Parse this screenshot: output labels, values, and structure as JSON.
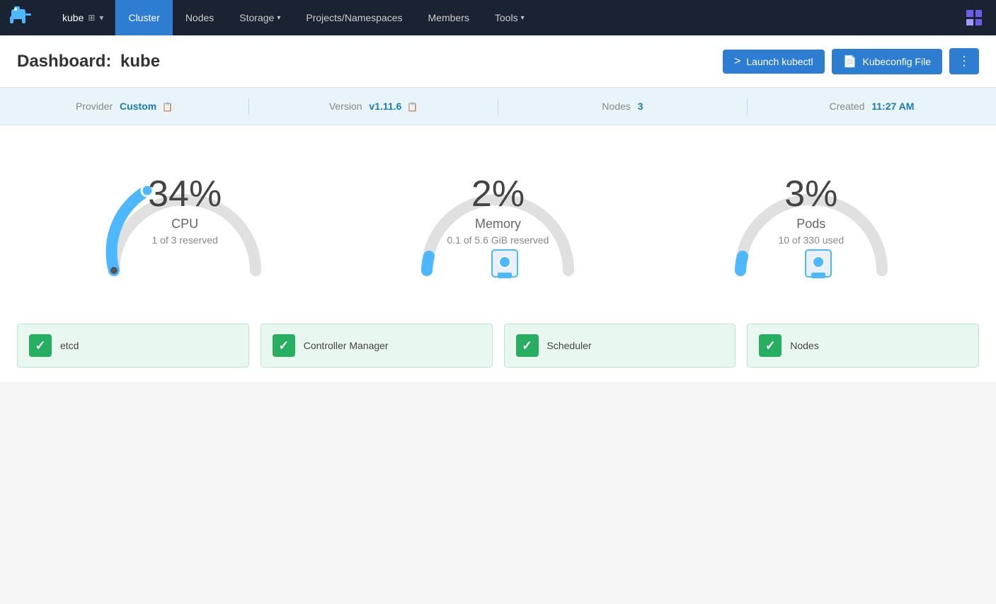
{
  "app": {
    "brand_icon": "🐘",
    "cluster_name": "kube",
    "cluster_icon": "⊞",
    "cluster_chevron": "▾"
  },
  "navbar": {
    "links": [
      {
        "id": "cluster",
        "label": "Cluster",
        "active": true,
        "has_dropdown": false
      },
      {
        "id": "nodes",
        "label": "Nodes",
        "active": false,
        "has_dropdown": false
      },
      {
        "id": "storage",
        "label": "Storage",
        "active": false,
        "has_dropdown": true
      },
      {
        "id": "projects",
        "label": "Projects/Namespaces",
        "active": false,
        "has_dropdown": false
      },
      {
        "id": "members",
        "label": "Members",
        "active": false,
        "has_dropdown": false
      },
      {
        "id": "tools",
        "label": "Tools",
        "active": false,
        "has_dropdown": true
      }
    ]
  },
  "page": {
    "title_prefix": "Dashboard:",
    "title_cluster": "kube"
  },
  "actions": {
    "launch_kubectl_label": "Launch kubectl",
    "kubeconfig_file_label": "Kubeconfig File",
    "more_label": "⋮"
  },
  "info_bar": {
    "provider_label": "Provider",
    "provider_value": "Custom",
    "version_label": "Version",
    "version_value": "v1.11.6",
    "nodes_label": "Nodes",
    "nodes_value": "3",
    "created_label": "Created",
    "created_value": "11:27 AM"
  },
  "gauges": [
    {
      "id": "cpu",
      "percent": "34%",
      "label": "CPU",
      "sublabel": "1 of 3 reserved",
      "fill_degrees": 220,
      "color": "#4db8ff",
      "value": 34
    },
    {
      "id": "memory",
      "percent": "2%",
      "label": "Memory",
      "sublabel": "0.1 of 5.6 GiB reserved",
      "color": "#4db8ff",
      "value": 2
    },
    {
      "id": "pods",
      "percent": "3%",
      "label": "Pods",
      "sublabel": "10 of 330 used",
      "color": "#4db8ff",
      "value": 3
    }
  ],
  "status_items": [
    {
      "id": "etcd",
      "label": "etcd",
      "status": "ok"
    },
    {
      "id": "controller-manager",
      "label": "Controller Manager",
      "status": "ok"
    },
    {
      "id": "scheduler",
      "label": "Scheduler",
      "status": "ok"
    },
    {
      "id": "nodes",
      "label": "Nodes",
      "status": "ok"
    }
  ]
}
